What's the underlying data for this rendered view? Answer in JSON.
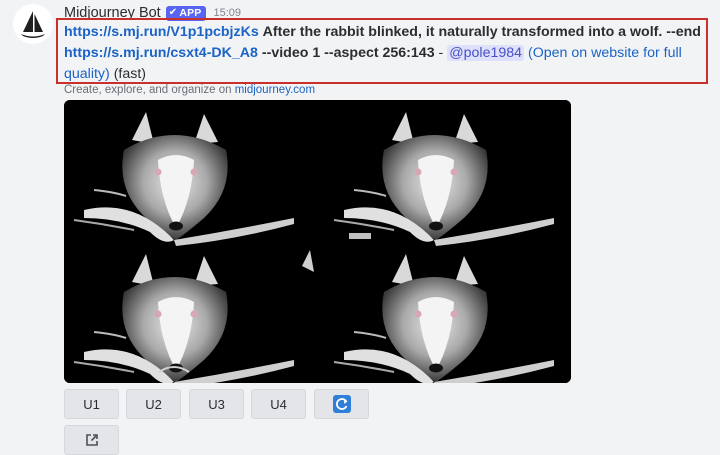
{
  "message": {
    "username": "Midjourney Bot",
    "badge": "APP",
    "timestamp": "15:09",
    "content": {
      "image_link": "https://s.mj.run/V1p1pcbjzKs",
      "prompt_text": "After the rabbit blinked, it naturally transformed into a wolf. --end",
      "end_link": "https://s.mj.run/csxt4-DK_A8",
      "params": "--video 1 --aspect 256:143",
      "separator": "-",
      "mention": "@pole1984",
      "website_link": "(Open on website for full quality)",
      "mode": "(fast)"
    },
    "embed": {
      "text": "Create, explore, and organize on",
      "link": "midjourney.com"
    }
  },
  "buttons": {
    "u1": "U1",
    "u2": "U2",
    "u3": "U3",
    "u4": "U4",
    "reroll_icon": "refresh-icon",
    "web_icon": "external-link-icon"
  },
  "colors": {
    "accent": "#5865f2",
    "link": "#1b63c6",
    "highlight_border": "#c9302c",
    "reroll": "#2f7fd9"
  }
}
